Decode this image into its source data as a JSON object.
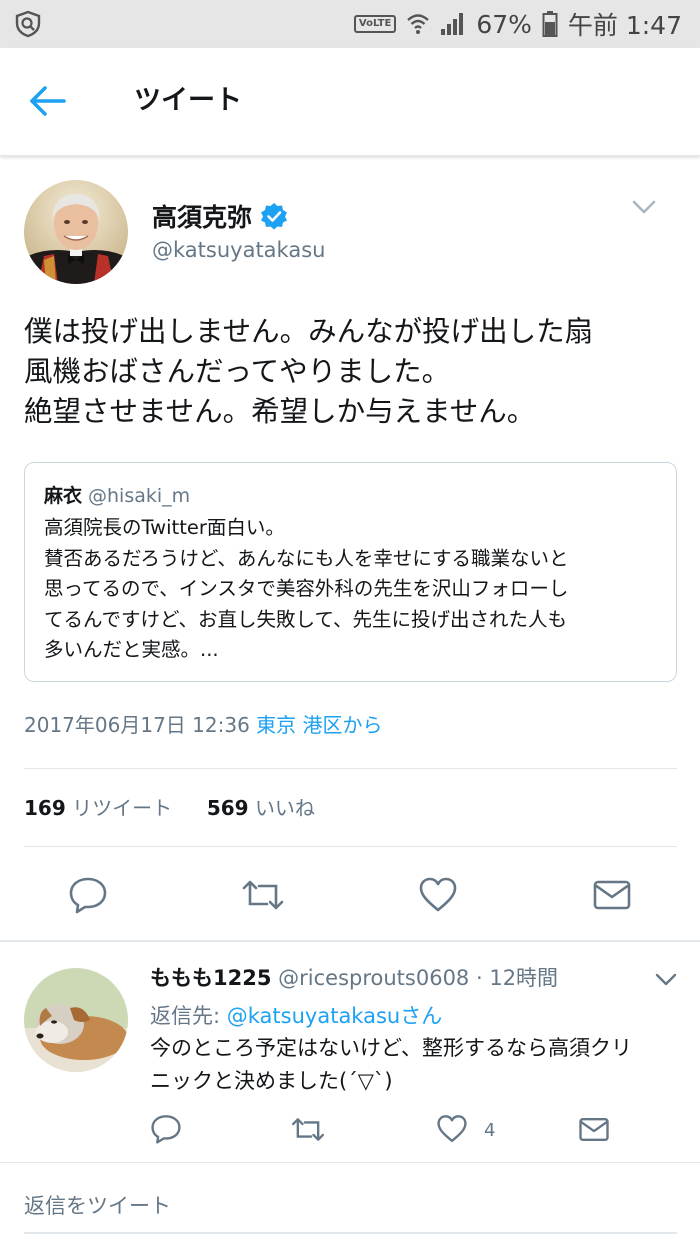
{
  "status_bar": {
    "volte": "VoLTE",
    "battery": "67%",
    "time": "午前 1:47"
  },
  "header": {
    "title": "ツイート",
    "back_icon": "arrow-left-icon"
  },
  "tweet": {
    "name": "高須克弥",
    "handle": "@katsuyatakasu",
    "verified_icon": "verified-badge-icon",
    "text": "僕は投げ出しません。みんなが投げ出した扇\n風機おばさんだってやりました。\n絶望させません。希望しか与えません。",
    "quote": {
      "name": "麻衣",
      "handle": "@hisaki_m",
      "text": "高須院長のTwitter面白い。\n賛否あるだろうけど、あんなにも人を幸せにする職業ないと\n思ってるので、インスタで美容外科の先生を沢山フォローし\nてるんですけど、お直し失敗して、先生に投げ出された人も\n多いんだと実感。..."
    },
    "timestamp": "2017年06月17日 12:36",
    "place": "東京 港区から",
    "retweet_count": "169",
    "retweet_label": "リツイート",
    "like_count": "569",
    "like_label": "いいね"
  },
  "reply": {
    "name": "ももも1225",
    "handle": "@ricesprouts0608",
    "time": "· 12時間",
    "reply_to_label": "返信先: ",
    "reply_to_mention": "@katsuyatakasuさん",
    "text": "今のところ予定はないけど、整形するなら高須クリ\nニックと決めました(´▽`)",
    "like_count": "4"
  },
  "compose": {
    "placeholder": "返信をツイート"
  },
  "colors": {
    "accent": "#1da1f2",
    "secondary_text": "#657786",
    "border": "#e1e8ed"
  }
}
